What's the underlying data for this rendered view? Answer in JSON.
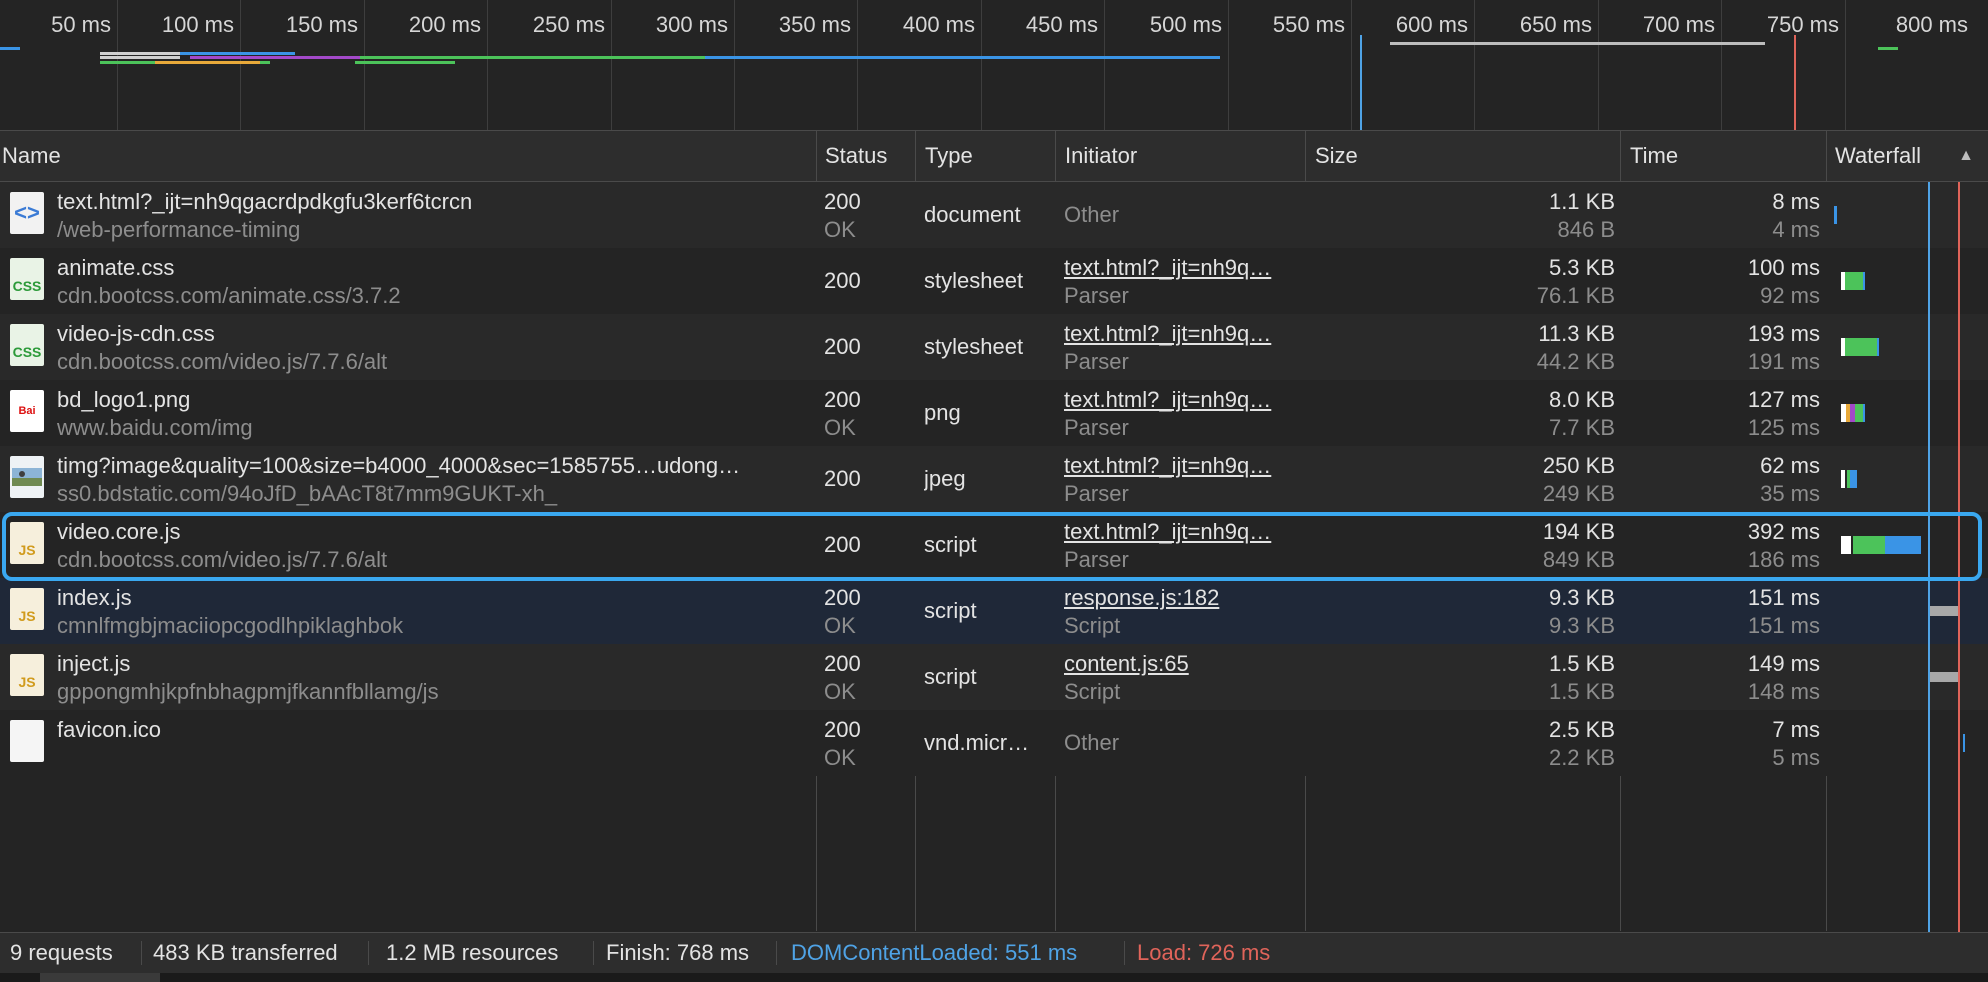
{
  "overview": {
    "tick_labels": [
      "50 ms",
      "100 ms",
      "150 ms",
      "200 ms",
      "250 ms",
      "300 ms",
      "350 ms",
      "400 ms",
      "450 ms",
      "500 ms",
      "550 ms",
      "600 ms",
      "650 ms",
      "700 ms",
      "750 ms",
      "800 ms"
    ]
  },
  "columns": {
    "name": "Name",
    "status": "Status",
    "type": "Type",
    "initiator": "Initiator",
    "size": "Size",
    "time": "Time",
    "waterfall": "Waterfall"
  },
  "sort_indicator": "▲",
  "requests": [
    {
      "name": "text.html?_ijt=nh9qgacrdpdkgfu3kerf6tcrcn",
      "path": "/web-performance-timing",
      "icon": "html-document-icon",
      "status": "200",
      "status_text": "OK",
      "type": "document",
      "initiator": "Other",
      "initiator_link": false,
      "initiator_sub": "",
      "size": "1.1 KB",
      "resource_size": "846 B",
      "time": "8 ms",
      "latency": "4 ms"
    },
    {
      "name": "animate.css",
      "path": "cdn.bootcss.com/animate.css/3.7.2",
      "icon": "css-file-icon",
      "status": "200",
      "status_text": "",
      "type": "stylesheet",
      "initiator": "text.html?_ijt=nh9q…",
      "initiator_link": true,
      "initiator_sub": "Parser",
      "size": "5.3 KB",
      "resource_size": "76.1 KB",
      "time": "100 ms",
      "latency": "92 ms"
    },
    {
      "name": "video-js-cdn.css",
      "path": "cdn.bootcss.com/video.js/7.7.6/alt",
      "icon": "css-file-icon",
      "status": "200",
      "status_text": "",
      "type": "stylesheet",
      "initiator": "text.html?_ijt=nh9q…",
      "initiator_link": true,
      "initiator_sub": "Parser",
      "size": "11.3 KB",
      "resource_size": "44.2 KB",
      "time": "193 ms",
      "latency": "191 ms"
    },
    {
      "name": "bd_logo1.png",
      "path": "www.baidu.com/img",
      "icon": "baidu-logo-icon",
      "status": "200",
      "status_text": "OK",
      "type": "png",
      "initiator": "text.html?_ijt=nh9q…",
      "initiator_link": true,
      "initiator_sub": "Parser",
      "size": "8.0 KB",
      "resource_size": "7.7 KB",
      "time": "127 ms",
      "latency": "125 ms"
    },
    {
      "name": "timg?image&quality=100&size=b4000_4000&sec=1585755…udong…",
      "path": "ss0.bdstatic.com/94oJfD_bAAcT8t7mm9GUKT-xh_",
      "icon": "image-thumbnail-icon",
      "status": "200",
      "status_text": "",
      "type": "jpeg",
      "initiator": "text.html?_ijt=nh9q…",
      "initiator_link": true,
      "initiator_sub": "Parser",
      "size": "250 KB",
      "resource_size": "249 KB",
      "time": "62 ms",
      "latency": "35 ms"
    },
    {
      "name": "video.core.js",
      "path": "cdn.bootcss.com/video.js/7.7.6/alt",
      "icon": "js-file-icon",
      "status": "200",
      "status_text": "",
      "type": "script",
      "initiator": "text.html?_ijt=nh9q…",
      "initiator_link": true,
      "initiator_sub": "Parser",
      "size": "194 KB",
      "resource_size": "849 KB",
      "time": "392 ms",
      "latency": "186 ms"
    },
    {
      "name": "index.js",
      "path": "cmnlfmgbjmaciiopcgodlhpiklaghbok",
      "icon": "js-file-icon",
      "status": "200",
      "status_text": "OK",
      "type": "script",
      "initiator": "response.js:182",
      "initiator_link": true,
      "initiator_sub": "Script",
      "size": "9.3 KB",
      "resource_size": "9.3 KB",
      "time": "151 ms",
      "latency": "151 ms"
    },
    {
      "name": "inject.js",
      "path": "gppongmhjkpfnbhagpmjfkannfbllamg/js",
      "icon": "js-file-icon",
      "status": "200",
      "status_text": "OK",
      "type": "script",
      "initiator": "content.js:65",
      "initiator_link": true,
      "initiator_sub": "Script",
      "size": "1.5 KB",
      "resource_size": "1.5 KB",
      "time": "149 ms",
      "latency": "148 ms"
    },
    {
      "name": "favicon.ico",
      "path": "",
      "icon": "blank-file-icon",
      "status": "200",
      "status_text": "OK",
      "type": "vnd.micr…",
      "initiator": "Other",
      "initiator_link": false,
      "initiator_sub": "",
      "size": "2.5 KB",
      "resource_size": "2.2 KB",
      "time": "7 ms",
      "latency": "5 ms"
    }
  ],
  "status_bar": {
    "requests": "9 requests",
    "transferred": "483 KB transferred",
    "resources": "1.2 MB resources",
    "finish": "Finish: 768 ms",
    "dom_content_loaded": "DOMContentLoaded: 551 ms",
    "load": "Load: 726 ms"
  },
  "colors": {
    "dom_content_loaded": "#4fa3e6",
    "load": "#e0645a",
    "highlight": "#3aa8f0",
    "waiting": "#4cc35a",
    "download": "#3a94e6"
  }
}
